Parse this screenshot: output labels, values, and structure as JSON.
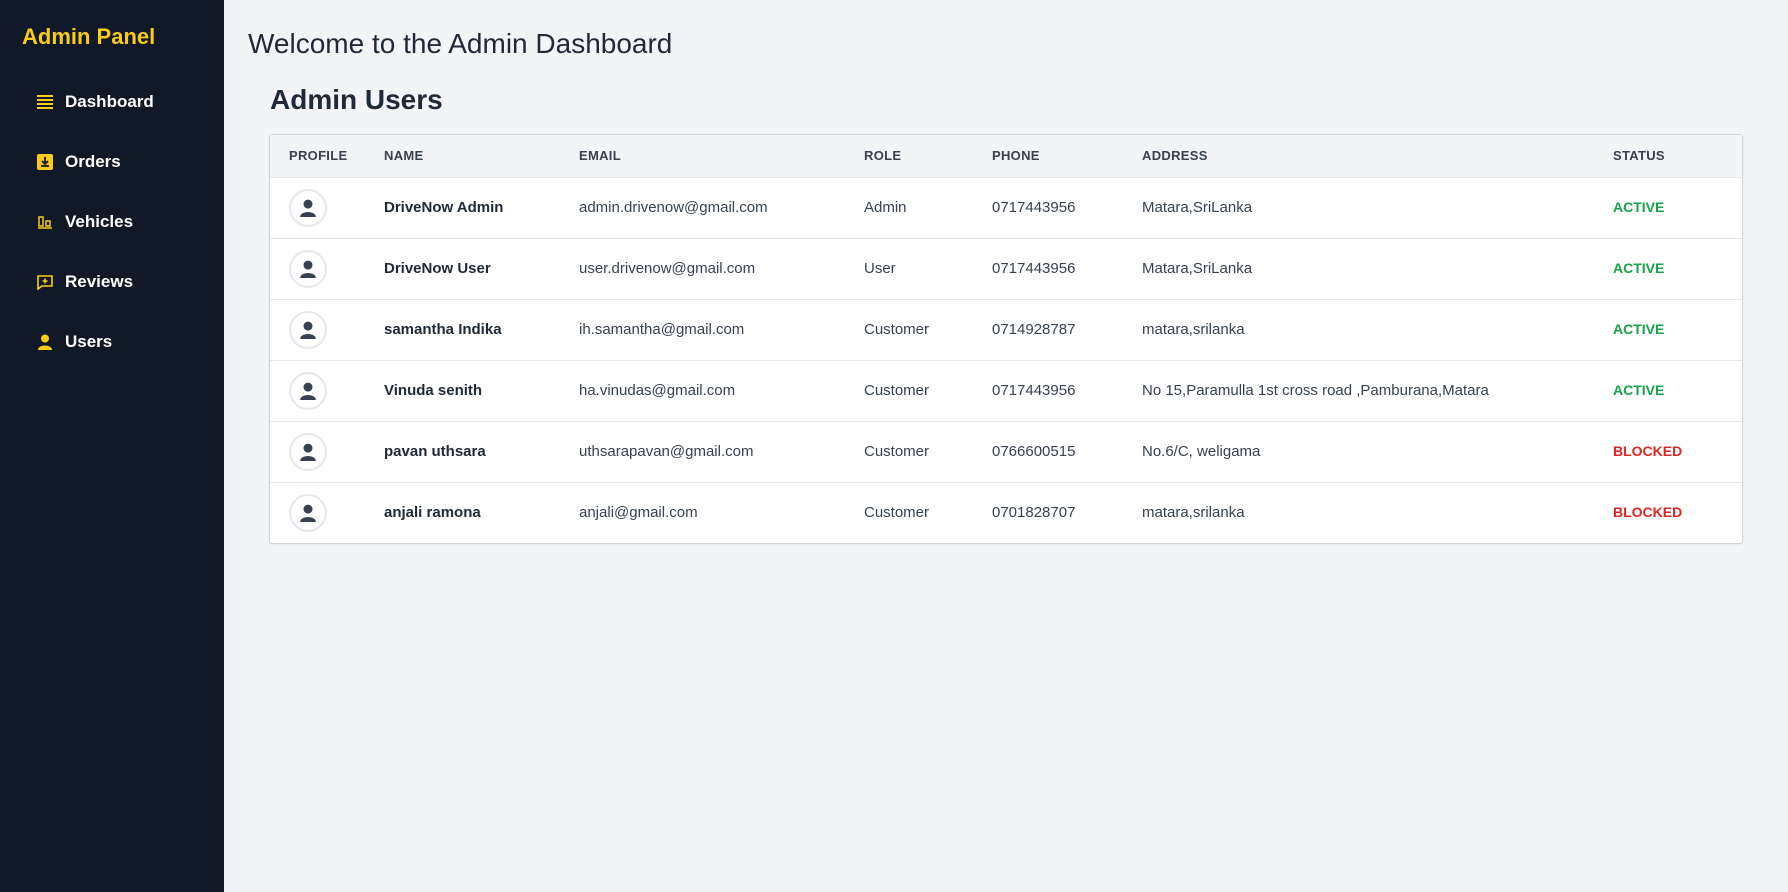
{
  "brand": "Admin Panel",
  "nav": [
    {
      "label": "Dashboard",
      "icon": "list-icon"
    },
    {
      "label": "Orders",
      "icon": "download-box-icon"
    },
    {
      "label": "Vehicles",
      "icon": "bar-chart-icon"
    },
    {
      "label": "Reviews",
      "icon": "message-plus-icon"
    },
    {
      "label": "Users",
      "icon": "user-icon"
    }
  ],
  "welcome": "Welcome to the Admin Dashboard",
  "section_title": "Admin Users",
  "table": {
    "headers": [
      "PROFILE",
      "NAME",
      "EMAIL",
      "ROLE",
      "PHONE",
      "ADDRESS",
      "STATUS"
    ],
    "rows": [
      {
        "name": "DriveNow Admin",
        "email": "admin.drivenow@gmail.com",
        "role": "Admin",
        "phone": "0717443956",
        "address": "Matara,SriLanka",
        "status": "ACTIVE"
      },
      {
        "name": "DriveNow User",
        "email": "user.drivenow@gmail.com",
        "role": "User",
        "phone": "0717443956",
        "address": "Matara,SriLanka",
        "status": "ACTIVE"
      },
      {
        "name": "samantha Indika",
        "email": "ih.samantha@gmail.com",
        "role": "Customer",
        "phone": "0714928787",
        "address": "matara,srilanka",
        "status": "ACTIVE"
      },
      {
        "name": "Vinuda senith",
        "email": "ha.vinudas@gmail.com",
        "role": "Customer",
        "phone": "0717443956",
        "address": "No 15,Paramulla 1st cross road ,Pamburana,Matara",
        "status": "ACTIVE"
      },
      {
        "name": "pavan uthsara",
        "email": "uthsarapavan@gmail.com",
        "role": "Customer",
        "phone": "0766600515",
        "address": "No.6/C, weligama",
        "status": "BLOCKED"
      },
      {
        "name": "anjali ramona",
        "email": "anjali@gmail.com",
        "role": "Customer",
        "phone": "0701828707",
        "address": "matara,srilanka",
        "status": "BLOCKED"
      }
    ]
  },
  "colors": {
    "sidebar_bg": "#111827",
    "accent": "#facc15",
    "active": "#16a34a",
    "blocked": "#dc2626"
  }
}
